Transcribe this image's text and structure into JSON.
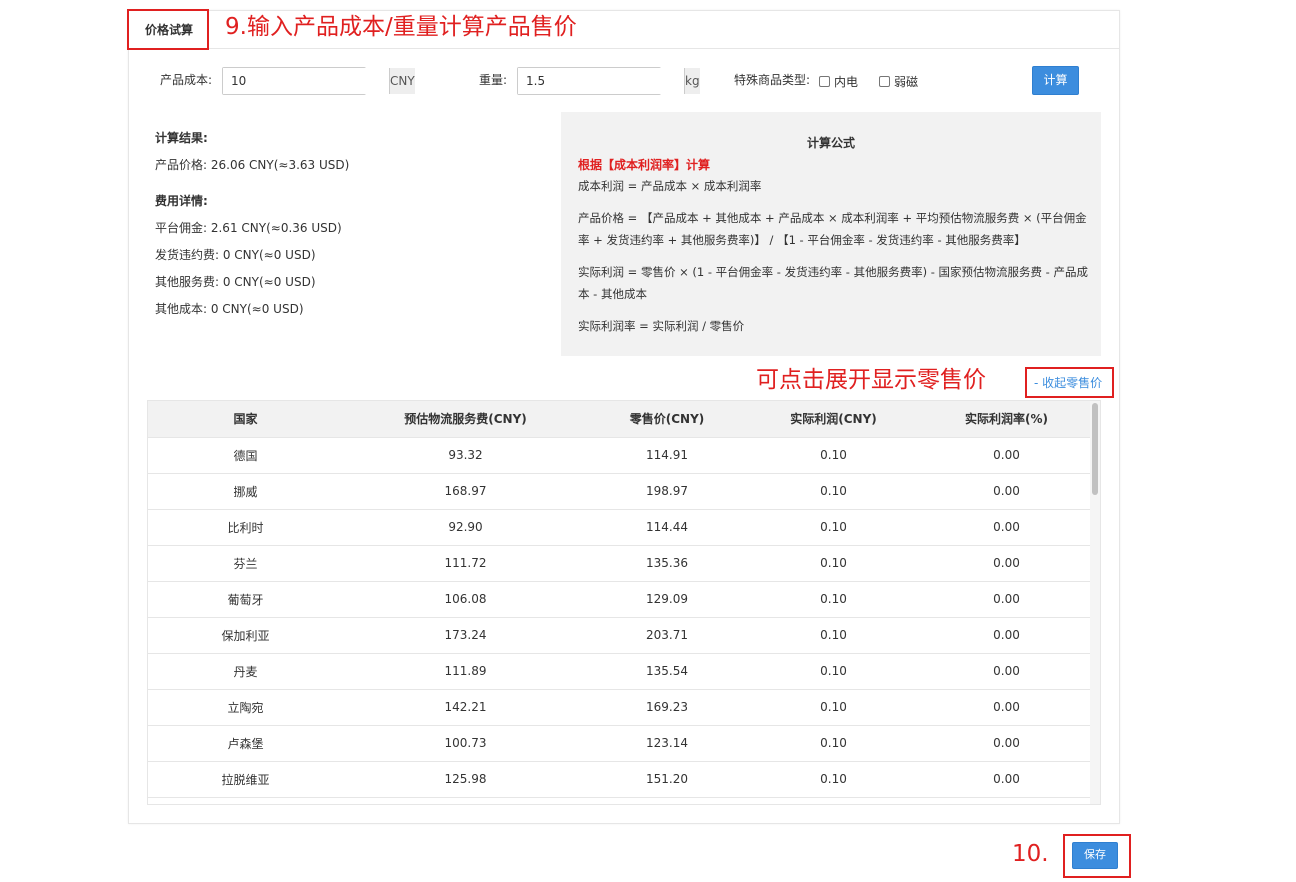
{
  "tab": {
    "title": "价格试算"
  },
  "annotations": {
    "step9": "9.输入产品成本/重量计算产品售价",
    "expand_hint": "可点击展开显示零售价",
    "step10": "10."
  },
  "form": {
    "cost_label": "产品成本:",
    "cost_value": "10",
    "cost_unit": "CNY",
    "weight_label": "重量:",
    "weight_value": "1.5",
    "weight_unit": "kg",
    "special_label": "特殊商品类型:",
    "special_options": [
      "内电",
      "弱磁"
    ],
    "calc_button": "计算"
  },
  "result": {
    "title": "计算结果:",
    "price_line": "产品价格:  26.06 CNY(≈3.63 USD)",
    "detail_title": "费用详情:",
    "details": [
      "平台佣金:  2.61 CNY(≈0.36 USD)",
      "发货违约费:  0 CNY(≈0 USD)",
      "其他服务费:  0 CNY(≈0 USD)",
      "其他成本:  0 CNY(≈0 USD)"
    ]
  },
  "formula": {
    "title": "计算公式",
    "basis": "根据【成本利润率】计算",
    "lines": [
      "成本利润 = 产品成本 × 成本利润率",
      "产品价格 = 【产品成本 + 其他成本 + 产品成本 × 成本利润率 + 平均预估物流服务费 × (平台佣金率 + 发货违约率 + 其他服务费率)】 / 【1 - 平台佣金率 - 发货违约率 - 其他服务费率】",
      "实际利润 = 零售价 × (1 - 平台佣金率 - 发货违约率 - 其他服务费率) - 国家预估物流服务费 - 产品成本 - 其他成本",
      "实际利润率 = 实际利润 / 零售价"
    ]
  },
  "toggle_link": "- 收起零售价",
  "table": {
    "headers": [
      "国家",
      "预估物流服务费(CNY)",
      "零售价(CNY)",
      "实际利润(CNY)",
      "实际利润率(%)"
    ],
    "rows": [
      [
        "德国",
        "93.32",
        "114.91",
        "0.10",
        "0.00"
      ],
      [
        "挪威",
        "168.97",
        "198.97",
        "0.10",
        "0.00"
      ],
      [
        "比利时",
        "92.90",
        "114.44",
        "0.10",
        "0.00"
      ],
      [
        "芬兰",
        "111.72",
        "135.36",
        "0.10",
        "0.00"
      ],
      [
        "葡萄牙",
        "106.08",
        "129.09",
        "0.10",
        "0.00"
      ],
      [
        "保加利亚",
        "173.24",
        "203.71",
        "0.10",
        "0.00"
      ],
      [
        "丹麦",
        "111.89",
        "135.54",
        "0.10",
        "0.00"
      ],
      [
        "立陶宛",
        "142.21",
        "169.23",
        "0.10",
        "0.00"
      ],
      [
        "卢森堡",
        "100.73",
        "123.14",
        "0.10",
        "0.00"
      ],
      [
        "拉脱维亚",
        "125.98",
        "151.20",
        "0.10",
        "0.00"
      ]
    ]
  },
  "save_button": "保存"
}
